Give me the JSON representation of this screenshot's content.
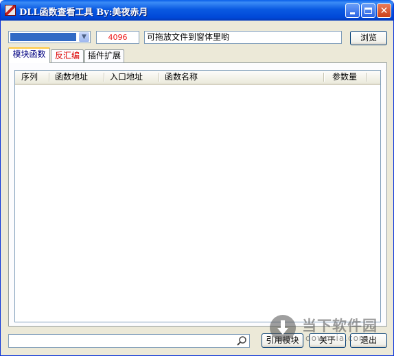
{
  "window": {
    "title": "DLL函数查看工具 By:美夜赤月",
    "minimize_icon": "minimize-icon",
    "maximize_icon": "maximize-icon",
    "close_icon": "close-icon"
  },
  "toolbar": {
    "process_select_value": "",
    "count_value": "4096",
    "count_color": "#ee1111",
    "path_value": "可拖放文件到窗体里哟",
    "browse_label": "浏览"
  },
  "tabs": [
    {
      "label": "模块函数",
      "color": "#000080",
      "active": true
    },
    {
      "label": "反汇编",
      "color": "#dd0000",
      "active": false
    },
    {
      "label": "插件扩展",
      "color": "#000000",
      "active": false
    }
  ],
  "table": {
    "columns": [
      "序列",
      "函数地址",
      "入口地址",
      "函数名称",
      "参数量"
    ],
    "rows": []
  },
  "bottom": {
    "search_value": "",
    "search_icon": "magnifier-icon",
    "import_module_label": "引用模块",
    "about_label": "关于",
    "exit_label": "退出"
  },
  "watermark": {
    "text": "当下软件园",
    "url": "downxia.com"
  },
  "colors": {
    "title_bar": "#0a5ae2",
    "selection": "#316ac5",
    "tab_highlight": "#ffc83c"
  }
}
